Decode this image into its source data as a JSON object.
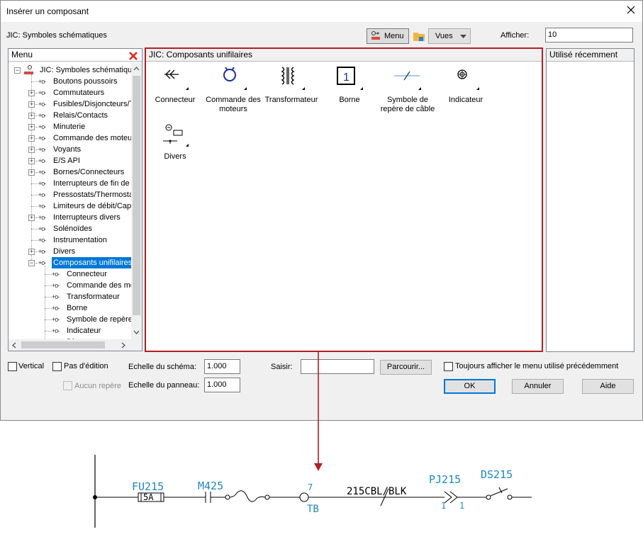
{
  "window": {
    "title": "Insérer un composant"
  },
  "header": {
    "library_label": "JIC: Symboles schématiques",
    "menu_button": "Menu",
    "views_button": "Vues",
    "show_label": "Afficher:",
    "show_value": "10"
  },
  "menu_panel": {
    "title": "Menu",
    "root": "JIC: Symboles schématiques",
    "items": [
      {
        "label": "Boutons poussoirs",
        "expandable": false
      },
      {
        "label": "Commutateurs",
        "expandable": true
      },
      {
        "label": "Fusibles/Disjoncteurs/T",
        "expandable": true
      },
      {
        "label": "Relais/Contacts",
        "expandable": true
      },
      {
        "label": "Minuterie",
        "expandable": true
      },
      {
        "label": "Commande des moteur",
        "expandable": true
      },
      {
        "label": "Voyants",
        "expandable": true
      },
      {
        "label": "E/S API",
        "expandable": true
      },
      {
        "label": "Bornes/Connecteurs",
        "expandable": true
      },
      {
        "label": "Interrupteurs de fin de c",
        "expandable": false
      },
      {
        "label": "Pressostats/Thermosta",
        "expandable": false
      },
      {
        "label": "Limiteurs de débit/Capt",
        "expandable": false
      },
      {
        "label": "Interrupteurs divers",
        "expandable": true
      },
      {
        "label": "Solénoïdes",
        "expandable": false
      },
      {
        "label": "Instrumentation",
        "expandable": false
      },
      {
        "label": "Divers",
        "expandable": true
      },
      {
        "label": "Composants unifilaires",
        "expandable": true,
        "selected": true
      }
    ],
    "children": [
      "Connecteur",
      "Commande des mo",
      "Transformateur",
      "Borne",
      "Symbole de repère",
      "Indicateur",
      "Divers"
    ]
  },
  "center_panel": {
    "title": "JIC: Composants unifilaires",
    "symbols": [
      {
        "label": "Connecteur",
        "icon": "connector-icon"
      },
      {
        "label": "Commande des moteurs",
        "icon": "motor-control-icon"
      },
      {
        "label": "Transformateur",
        "icon": "transformer-icon"
      },
      {
        "label": "Borne",
        "icon": "terminal-icon"
      },
      {
        "label": "Symbole de repère de câble",
        "icon": "cable-marker-icon"
      },
      {
        "label": "Indicateur",
        "icon": "indicator-icon"
      },
      {
        "label": "Divers",
        "icon": "misc-icon"
      }
    ]
  },
  "recent_panel": {
    "title": "Utilisé récemment"
  },
  "footer": {
    "vertical": "Vertical",
    "no_edit": "Pas d'édition",
    "no_marker": "Aucun repère",
    "schema_scale_label": "Echelle du schéma:",
    "schema_scale_value": "1.000",
    "panel_scale_label": "Echelle du panneau:",
    "panel_scale_value": "1.000",
    "input_label": "Saisir:",
    "input_value": "",
    "browse": "Parcourir...",
    "always_show": "Toujours afficher le menu utilisé précédemment",
    "ok": "OK",
    "cancel": "Annuler",
    "help": "Aide"
  },
  "drawing": {
    "fuse_tag": "FU215",
    "fuse_rating": "5A",
    "motor_tag": "M425",
    "terminal_number": "7",
    "terminal_tag": "TB",
    "cable_label": "215CBL/BLK",
    "connector_tag": "PJ215",
    "connector_left_pin": "1",
    "connector_right_pin": "1",
    "switch_tag": "DS215"
  },
  "colors": {
    "accent": "#b22025",
    "selection": "#0078d7",
    "cad_blue": "#1e86c8"
  }
}
